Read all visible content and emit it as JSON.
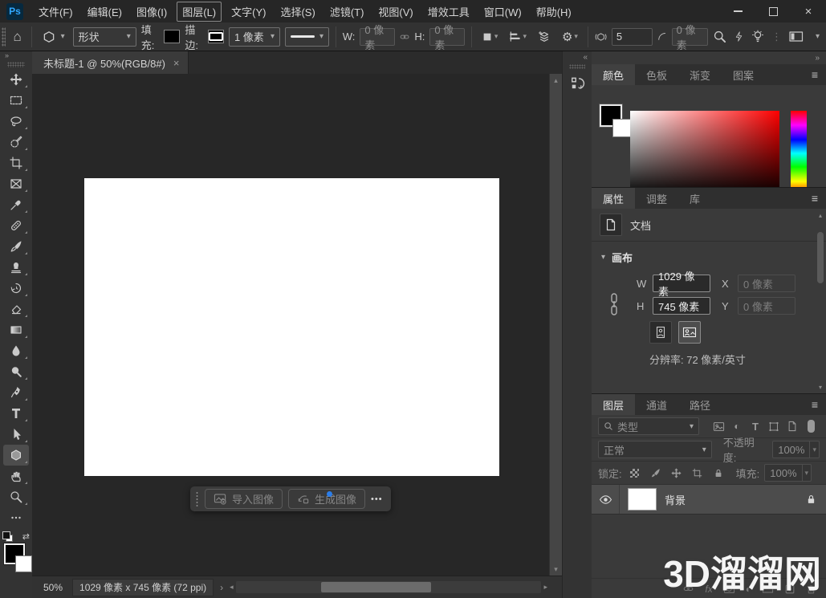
{
  "menu": {
    "logo": "Ps",
    "items": [
      "文件(F)",
      "编辑(E)",
      "图像(I)",
      "图层(L)",
      "文字(Y)",
      "选择(S)",
      "滤镜(T)",
      "视图(V)",
      "增效工具",
      "窗口(W)",
      "帮助(H)"
    ]
  },
  "options": {
    "mode_value": "形状",
    "fill_label": "填充:",
    "stroke_label": "描边:",
    "stroke_width_value": "1 像素",
    "w_label": "W:",
    "w_value": "0 像素",
    "h_label": "H:",
    "h_value": "0 像素",
    "sides_value": "5",
    "radius_value": "0 像素"
  },
  "doc_tab": {
    "title": "未标题-1 @ 50%(RGB/8#)"
  },
  "taskbar": {
    "import_label": "导入图像",
    "generate_label": "生成图像"
  },
  "status": {
    "zoom": "50%",
    "dimensions": "1029 像素 x 745 像素 (72 ppi)"
  },
  "color_panel": {
    "tabs": [
      "颜色",
      "色板",
      "渐变",
      "图案"
    ]
  },
  "properties_panel": {
    "tabs": [
      "属性",
      "调整",
      "库"
    ],
    "document_label": "文档",
    "canvas_section_label": "画布",
    "w_label": "W",
    "w_value": "1029 像素",
    "x_label": "X",
    "x_value": "0 像素",
    "h_label": "H",
    "h_value": "745 像素",
    "y_label": "Y",
    "y_value": "0 像素",
    "resolution": "分辨率: 72 像素/英寸"
  },
  "layers_panel": {
    "tabs": [
      "图层",
      "通道",
      "路径"
    ],
    "filter_label": "类型",
    "blend_mode_value": "正常",
    "opacity_label": "不透明度:",
    "opacity_value": "100%",
    "lock_label": "锁定:",
    "fill_label": "填充:",
    "fill_value": "100%",
    "layer_name": "背景"
  },
  "watermark": {
    "text": "3D溜溜网"
  },
  "icons": {
    "hamburger": "≡",
    "chevron_down": "▾",
    "chevron_up": "▴",
    "chevron_left": "◂",
    "chevron_right": "▸",
    "collapse_right": "»",
    "collapse_left": "«",
    "close": "×",
    "more_h": "•••",
    "gear": "⚙",
    "home": "⌂",
    "half_circle": "◐",
    "type_T": "T",
    "fx": "fx",
    "swap": "⇄",
    "hue_pointer": "▶",
    "angle_arrow": "›"
  },
  "colors": {
    "ps_logo_bg": "#06293f",
    "ps_logo_text": "#31a8ff",
    "generate_badge": "#2b7de9",
    "canvas_white": "#ffffff",
    "hue_top": "#ff0000"
  }
}
